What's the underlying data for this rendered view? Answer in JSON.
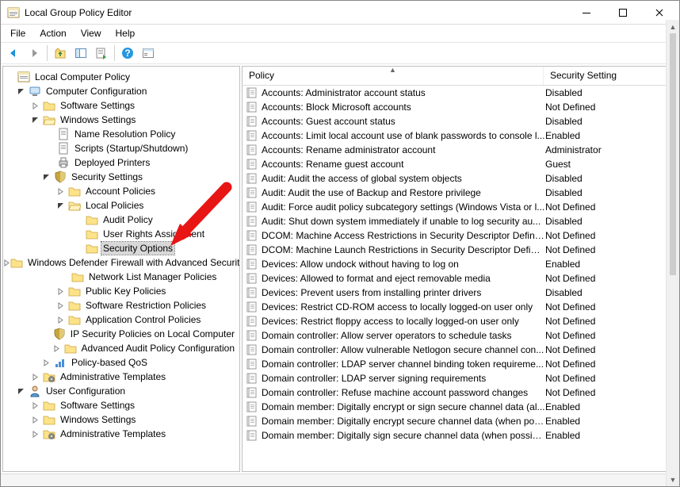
{
  "window": {
    "title": "Local Group Policy Editor"
  },
  "menu": {
    "file": "File",
    "action": "Action",
    "view": "View",
    "help": "Help"
  },
  "tree": {
    "root": "Local Computer Policy",
    "computer_config": "Computer Configuration",
    "software_settings": "Software Settings",
    "windows_settings": "Windows Settings",
    "name_resolution": "Name Resolution Policy",
    "scripts": "Scripts (Startup/Shutdown)",
    "deployed_printers": "Deployed Printers",
    "security_settings": "Security Settings",
    "account_policies": "Account Policies",
    "local_policies": "Local Policies",
    "audit_policy": "Audit Policy",
    "user_rights": "User Rights Assignment",
    "security_options": "Security Options",
    "wdf": "Windows Defender Firewall with Advanced Security",
    "nlm": "Network List Manager Policies",
    "pkp": "Public Key Policies",
    "srp": "Software Restriction Policies",
    "acp": "Application Control Policies",
    "ipsec": "IP Security Policies on Local Computer",
    "aapc": "Advanced Audit Policy Configuration",
    "qos": "Policy-based QoS",
    "admin_templates_c": "Administrative Templates",
    "user_config": "User Configuration",
    "software_settings_u": "Software Settings",
    "windows_settings_u": "Windows Settings",
    "admin_templates_u": "Administrative Templates"
  },
  "columns": {
    "policy": "Policy",
    "setting": "Security Setting"
  },
  "policies": [
    {
      "name": "Accounts: Administrator account status",
      "setting": "Disabled"
    },
    {
      "name": "Accounts: Block Microsoft accounts",
      "setting": "Not Defined"
    },
    {
      "name": "Accounts: Guest account status",
      "setting": "Disabled"
    },
    {
      "name": "Accounts: Limit local account use of blank passwords to console l...",
      "setting": "Enabled"
    },
    {
      "name": "Accounts: Rename administrator account",
      "setting": "Administrator"
    },
    {
      "name": "Accounts: Rename guest account",
      "setting": "Guest"
    },
    {
      "name": "Audit: Audit the access of global system objects",
      "setting": "Disabled"
    },
    {
      "name": "Audit: Audit the use of Backup and Restore privilege",
      "setting": "Disabled"
    },
    {
      "name": "Audit: Force audit policy subcategory settings (Windows Vista or l...",
      "setting": "Not Defined"
    },
    {
      "name": "Audit: Shut down system immediately if unable to log security au...",
      "setting": "Disabled"
    },
    {
      "name": "DCOM: Machine Access Restrictions in Security Descriptor Definiti...",
      "setting": "Not Defined"
    },
    {
      "name": "DCOM: Machine Launch Restrictions in Security Descriptor Definit...",
      "setting": "Not Defined"
    },
    {
      "name": "Devices: Allow undock without having to log on",
      "setting": "Enabled"
    },
    {
      "name": "Devices: Allowed to format and eject removable media",
      "setting": "Not Defined"
    },
    {
      "name": "Devices: Prevent users from installing printer drivers",
      "setting": "Disabled"
    },
    {
      "name": "Devices: Restrict CD-ROM access to locally logged-on user only",
      "setting": "Not Defined"
    },
    {
      "name": "Devices: Restrict floppy access to locally logged-on user only",
      "setting": "Not Defined"
    },
    {
      "name": "Domain controller: Allow server operators to schedule tasks",
      "setting": "Not Defined"
    },
    {
      "name": "Domain controller: Allow vulnerable Netlogon secure channel con...",
      "setting": "Not Defined"
    },
    {
      "name": "Domain controller: LDAP server channel binding token requireme...",
      "setting": "Not Defined"
    },
    {
      "name": "Domain controller: LDAP server signing requirements",
      "setting": "Not Defined"
    },
    {
      "name": "Domain controller: Refuse machine account password changes",
      "setting": "Not Defined"
    },
    {
      "name": "Domain member: Digitally encrypt or sign secure channel data (al...",
      "setting": "Enabled"
    },
    {
      "name": "Domain member: Digitally encrypt secure channel data (when pos...",
      "setting": "Enabled"
    },
    {
      "name": "Domain member: Digitally sign secure channel data (when possible)",
      "setting": "Enabled"
    }
  ]
}
